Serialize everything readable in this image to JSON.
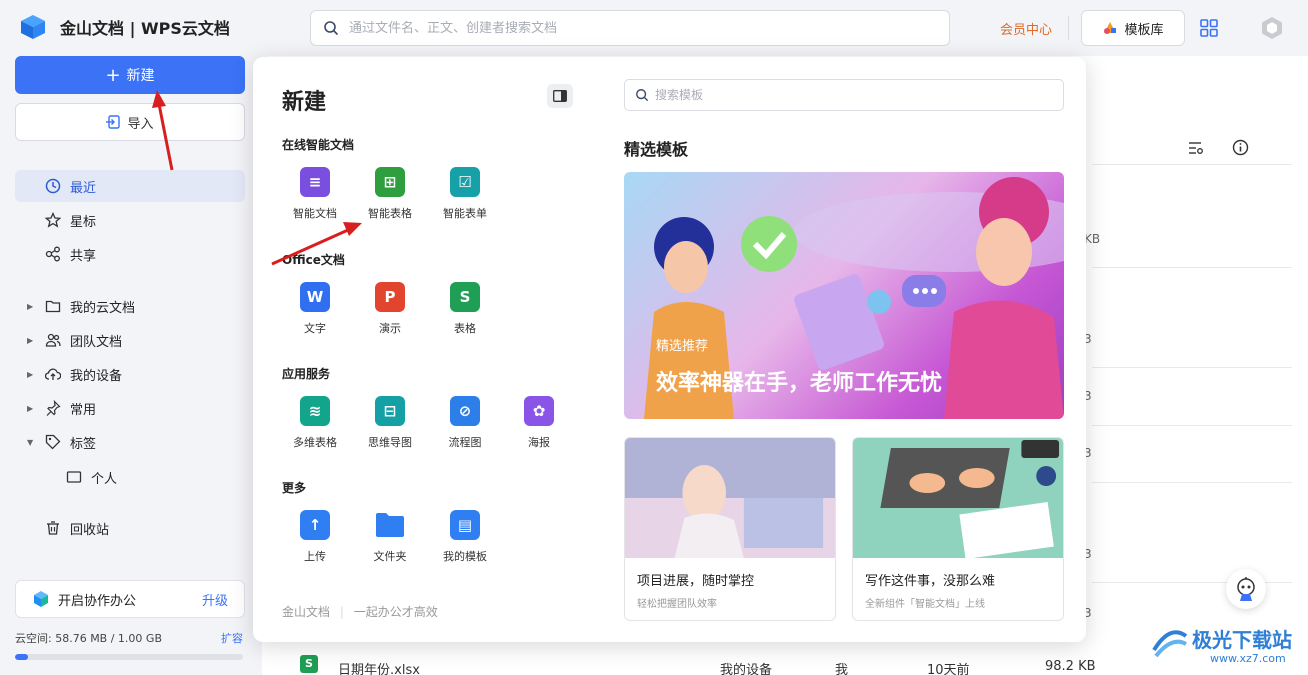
{
  "header": {
    "app_title": "金山文档 | WPS云文档",
    "search_placeholder": "通过文件名、正文、创建者搜索文档",
    "member_center": "会员中心",
    "template_library": "模板库"
  },
  "sidebar": {
    "new_label": "新建",
    "import_label": "导入",
    "items": [
      {
        "label": "最近",
        "icon": "clock-icon",
        "active": true
      },
      {
        "label": "星标",
        "icon": "star-icon"
      },
      {
        "label": "共享",
        "icon": "share-icon"
      },
      {
        "label": "我的云文档",
        "icon": "folder-icon"
      },
      {
        "label": "团队文档",
        "icon": "team-icon"
      },
      {
        "label": "我的设备",
        "icon": "cloud-upload-icon"
      },
      {
        "label": "常用",
        "icon": "pin-icon"
      },
      {
        "label": "标签",
        "icon": "tag-icon"
      },
      {
        "label": "个人",
        "icon": "label-box-icon"
      },
      {
        "label": "回收站",
        "icon": "trash-icon"
      }
    ],
    "collab": {
      "label": "开启协作办公",
      "upgrade": "升级"
    },
    "space": {
      "text": "云空间: 58.76 MB / 1.00 GB",
      "expand": "扩容",
      "used_fraction": 0.0574
    }
  },
  "popup": {
    "title": "新建",
    "sections": [
      {
        "title": "在线智能文档",
        "apps": [
          {
            "label": "智能文档",
            "color": "#7a4fe0",
            "glyph": "≡"
          },
          {
            "label": "智能表格",
            "color": "#2e9e3e",
            "glyph": "⊞"
          },
          {
            "label": "智能表单",
            "color": "#16a1a8",
            "glyph": "☑"
          }
        ]
      },
      {
        "title": "Office文档",
        "apps": [
          {
            "label": "文字",
            "color": "#2f6ff0",
            "glyph": "W"
          },
          {
            "label": "演示",
            "color": "#e2452e",
            "glyph": "P"
          },
          {
            "label": "表格",
            "color": "#1f9e55",
            "glyph": "S"
          }
        ]
      },
      {
        "title": "应用服务",
        "apps": [
          {
            "label": "多维表格",
            "color": "#13a58c",
            "glyph": "≋"
          },
          {
            "label": "思维导图",
            "color": "#14a0a5",
            "glyph": "⊟"
          },
          {
            "label": "流程图",
            "color": "#2c7ee8",
            "glyph": "⊘"
          },
          {
            "label": "海报",
            "color": "#8a55e6",
            "glyph": "✿"
          }
        ]
      },
      {
        "title": "更多",
        "apps": [
          {
            "label": "上传",
            "color": "#2f7ef2",
            "glyph": "↑"
          },
          {
            "label": "文件夹",
            "color": "#2f7ef2",
            "glyph": ""
          },
          {
            "label": "我的模板",
            "color": "#2f7ef2",
            "glyph": "▤"
          }
        ]
      }
    ],
    "footer_brand": "金山文档",
    "footer_slogan": "一起办公才高效",
    "template_search_placeholder": "搜索模板",
    "featured_title": "精选模板",
    "hero": {
      "tag": "精选推荐",
      "headline": "效率神器在手，老师工作无忧"
    },
    "cards": [
      {
        "title": "项目进展，随时掌控",
        "subtitle": "轻松把握团队效率"
      },
      {
        "title": "写作这件事，没那么难",
        "subtitle": "全新组件「智能文档」上线"
      }
    ]
  },
  "background_list": {
    "sizes": [
      "KB",
      "3",
      "3",
      "3",
      "3",
      "3",
      "3",
      "3"
    ],
    "last_row": {
      "name": "日期年份.xlsx",
      "location": "我的设备",
      "owner": "我",
      "time": "10天前",
      "size": "98.2 KB"
    }
  },
  "watermark": {
    "title": "极光下载站",
    "url": "www.xz7.com"
  },
  "colors": {
    "accent": "#3b72f6",
    "annotation": "#d81e1e"
  }
}
